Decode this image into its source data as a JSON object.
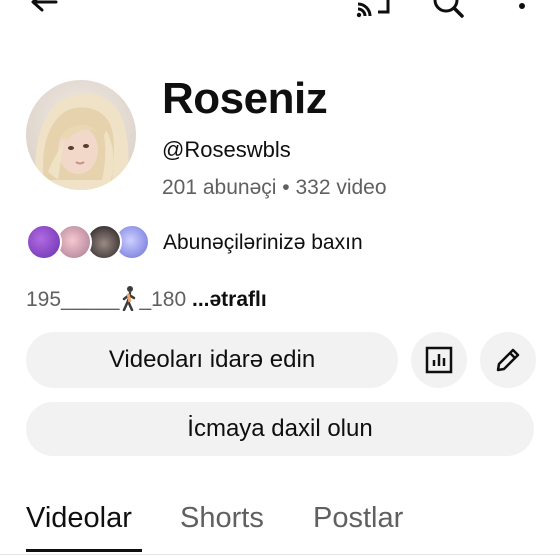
{
  "topbar": {
    "back_icon": "arrow-left-icon",
    "cast_icon": "cast-icon",
    "search_icon": "search-icon",
    "more_icon": "more-vertical-icon"
  },
  "channel": {
    "name": "Roseniz",
    "handle": "@Roseswbls",
    "stats": "201 abunəçi • 332 video"
  },
  "subscribers_link": "Abunəçilərinizə baxın",
  "bio": {
    "prefix": "195_____",
    "suffix": "_180",
    "more_label": "...ətraflı"
  },
  "buttons": {
    "manage_videos": "Videoları idarə edin",
    "analytics_icon": "bar-chart-icon",
    "edit_icon": "pencil-icon",
    "join_community": "İcmaya daxil olun"
  },
  "tabs": [
    {
      "label": "Videolar",
      "active": true
    },
    {
      "label": "Shorts",
      "active": false
    },
    {
      "label": "Postlar",
      "active": false
    }
  ],
  "colors": {
    "text_primary": "#0f0f0f",
    "text_secondary": "#606060",
    "button_bg": "#f2f2f2"
  }
}
